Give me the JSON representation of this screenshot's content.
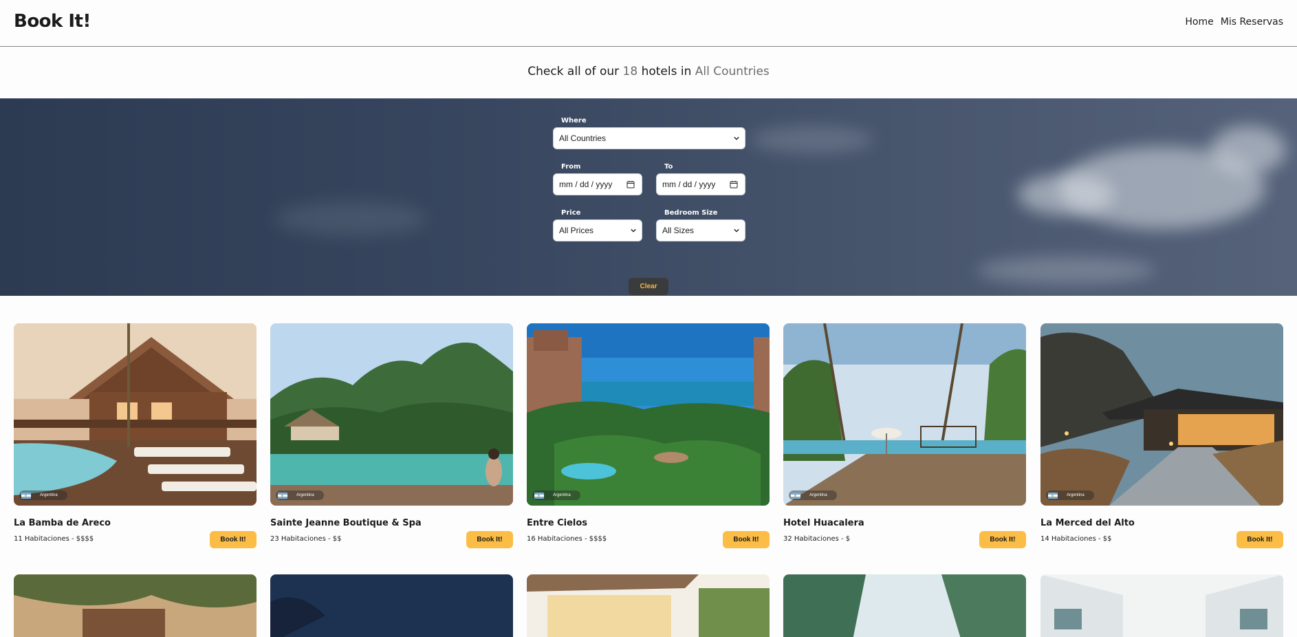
{
  "nav": {
    "brand": "Book It!",
    "links": [
      "Home",
      "Mis Reservas"
    ]
  },
  "headline": {
    "prefix": "Check all of our",
    "count": "18",
    "middle": "hotels in",
    "location": "All Countries"
  },
  "filters": {
    "where_label": "Where",
    "where_value": "All Countries",
    "from_label": "From",
    "from_value": "mm / dd / yyyy",
    "to_label": "To",
    "to_value": "mm / dd / yyyy",
    "price_label": "Price",
    "price_value": "All Prices",
    "size_label": "Bedroom Size",
    "size_value": "All Sizes",
    "clear_label": "Clear"
  },
  "hotels": [
    {
      "name": "La Bamba de Areco",
      "meta": "11 Habitaciones - $$$$",
      "country": "Argentina",
      "button": "Book It!"
    },
    {
      "name": "Sainte Jeanne Boutique & Spa",
      "meta": "23 Habitaciones - $$",
      "country": "Argentina",
      "button": "Book It!"
    },
    {
      "name": "Entre Cielos",
      "meta": "16 Habitaciones - $$$$",
      "country": "Argentina",
      "button": "Book It!"
    },
    {
      "name": "Hotel Huacalera",
      "meta": "32 Habitaciones - $",
      "country": "Argentina",
      "button": "Book It!"
    },
    {
      "name": "La Merced del Alto",
      "meta": "14 Habitaciones - $$",
      "country": "Argentina",
      "button": "Book It!"
    }
  ],
  "colors": {
    "accent": "#fbbd45",
    "clear_button": "#3a3b3c",
    "clear_text": "#f5b84a"
  }
}
